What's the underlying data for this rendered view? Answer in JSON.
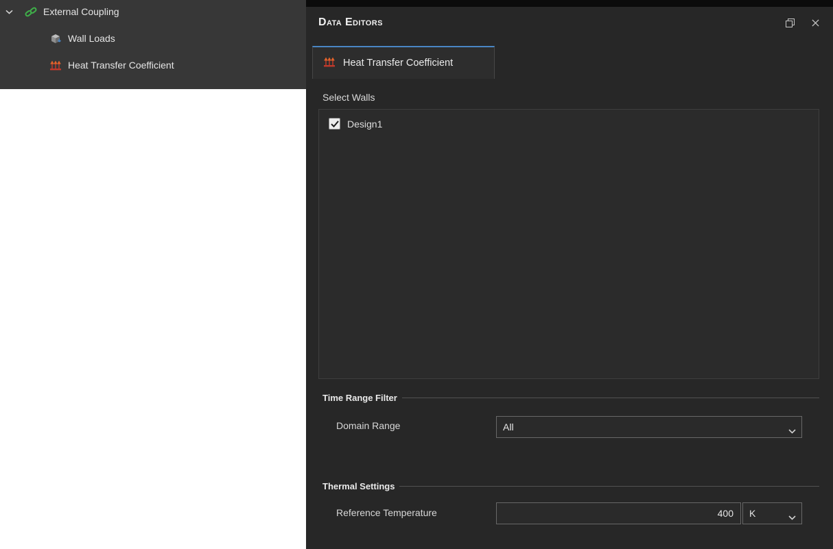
{
  "colors": {
    "accent_blue": "#4a86c5",
    "link_green": "#3fae49",
    "heat_orange": "#e2622b",
    "heat_red": "#c0392b",
    "panel_bg": "#272727",
    "tree_bg": "#373737"
  },
  "tree": {
    "items": [
      {
        "label": "External Coupling",
        "icon": "link-icon",
        "expanded": true
      },
      {
        "label": "Wall Loads",
        "icon": "wall-loads-icon"
      },
      {
        "label": "Heat Transfer Coefficient",
        "icon": "heat-icon"
      }
    ]
  },
  "data_editors": {
    "title": "Data Editors",
    "tab_label": "Heat Transfer Coefficient",
    "select_walls_label": "Select Walls",
    "wall_items": [
      {
        "label": "Design1",
        "checked": true
      }
    ],
    "time_range_group": {
      "title": "Time Range Filter",
      "domain_range_label": "Domain Range",
      "domain_range_value": "All"
    },
    "thermal_group": {
      "title": "Thermal Settings",
      "reference_temperature_label": "Reference Temperature",
      "reference_temperature_value": "400",
      "reference_temperature_unit": "K"
    }
  }
}
